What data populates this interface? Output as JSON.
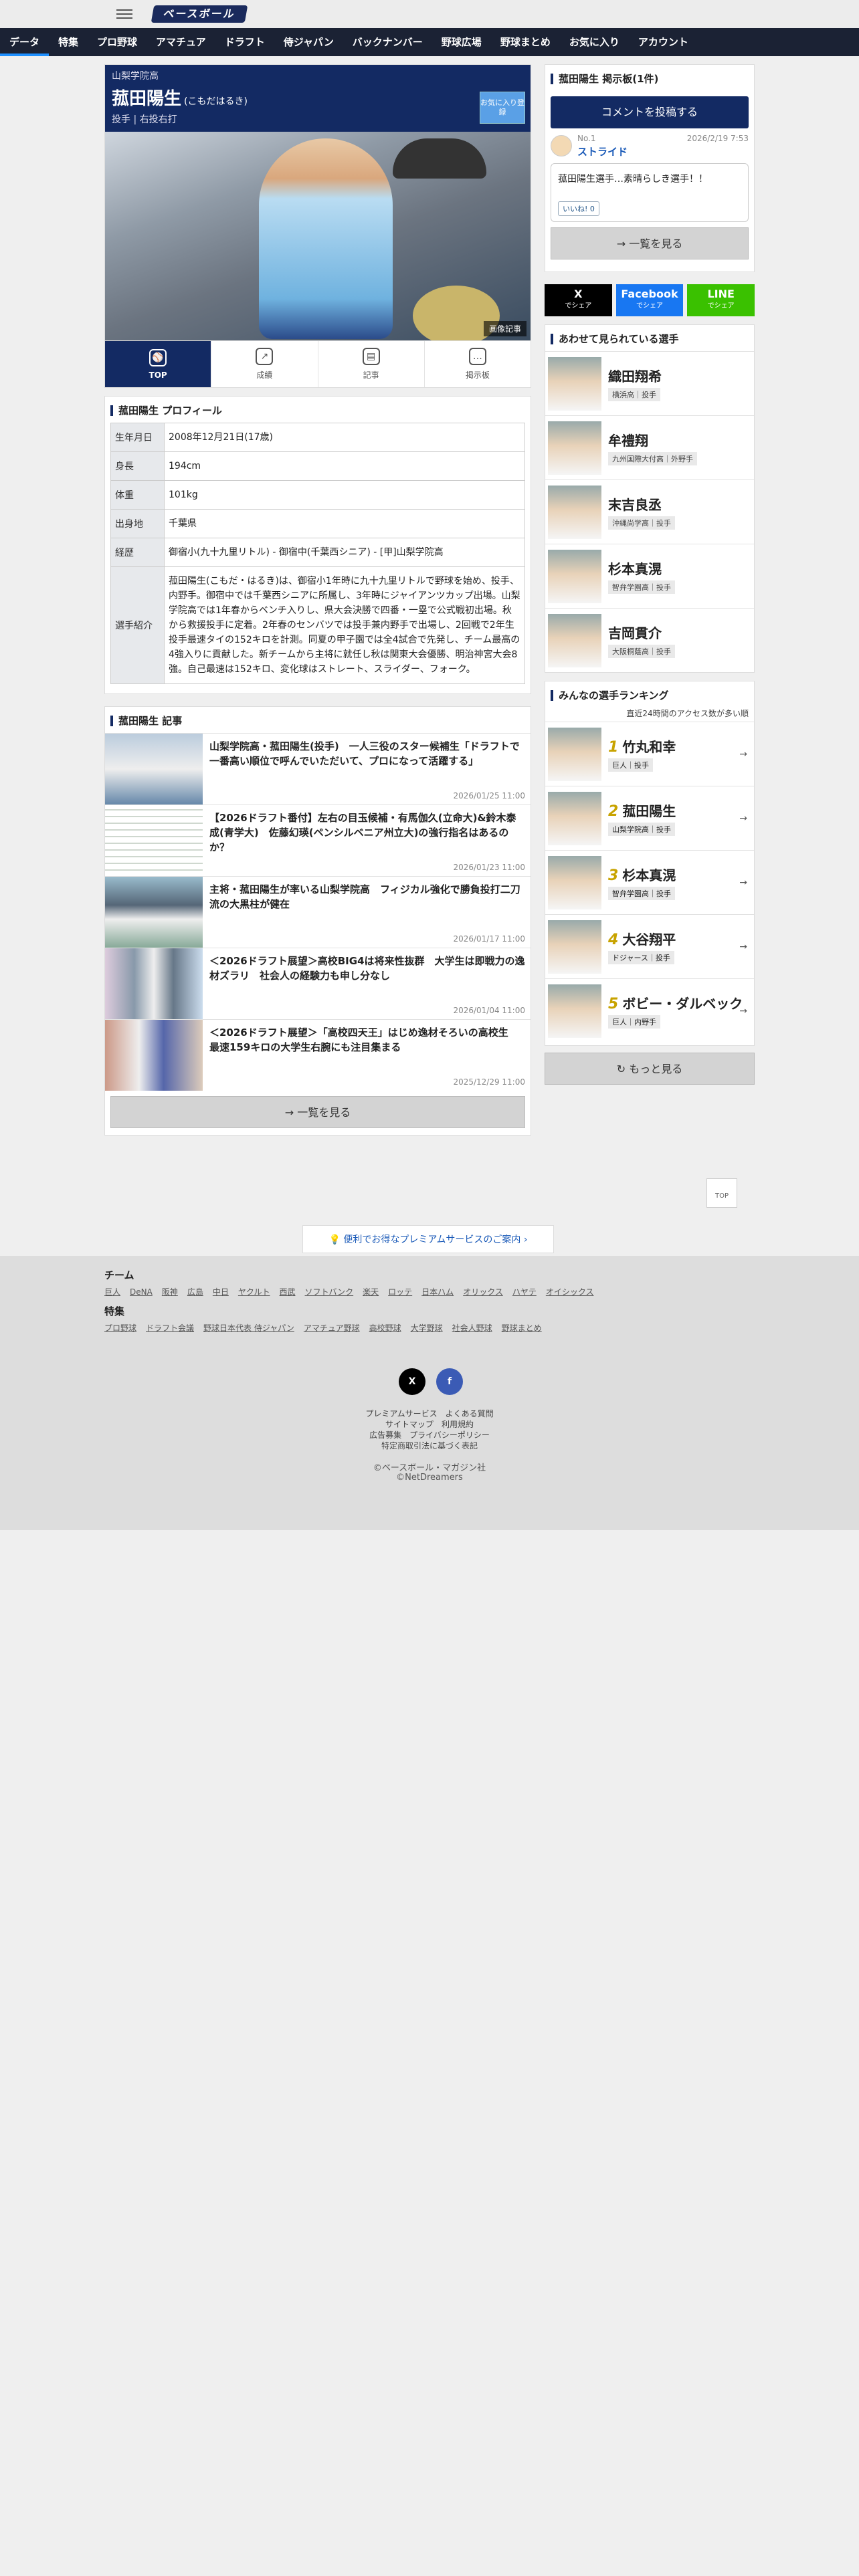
{
  "header": {
    "logo": "ベースボール"
  },
  "nav": [
    "データ",
    "特集",
    "プロ野球",
    "アマチュア",
    "ドラフト",
    "侍ジャパン",
    "バックナンバー",
    "野球広場",
    "野球まとめ",
    "お気に入り",
    "アカウント"
  ],
  "player": {
    "school": "山梨学院高",
    "name": "菰田陽生",
    "kana": "(こもだはるき)",
    "position": "投手 | 右投右打",
    "fav_label": "お気に入り登録",
    "image_tag": "画像記事"
  },
  "tabs": [
    "TOP",
    "成績",
    "記事",
    "掲示板"
  ],
  "profile": {
    "title": "菰田陽生 プロフィール",
    "rows": [
      {
        "k": "生年月日",
        "v": "2008年12月21日(17歳)"
      },
      {
        "k": "身長",
        "v": "194cm"
      },
      {
        "k": "体重",
        "v": "101kg"
      },
      {
        "k": "出身地",
        "v": "千葉県"
      },
      {
        "k": "経歴",
        "v": "御宿小(九十九里リトル) - 御宿中(千葉西シニア) - [甲]山梨学院高"
      },
      {
        "k": "選手紹介",
        "v": "菰田陽生(こもだ・はるき)は、御宿小1年時に九十九里リトルで野球を始め、投手、内野手。御宿中では千葉西シニアに所属し、3年時にジャイアンツカップ出場。山梨学院高では1年春からベンチ入りし、県大会決勝で四番・一塁で公式戦初出場。秋から救援投手に定着。2年春のセンバツでは投手兼内野手で出場し、2回戦で2年生投手最速タイの152キロを計測。同夏の甲子園では全4試合で先発し、チーム最高の4強入りに貢献した。新チームから主将に就任し秋は関東大会優勝、明治神宮大会8強。自己最速は152キロ、変化球はストレート、スライダー、フォーク。"
      }
    ]
  },
  "articles": {
    "title": "菰田陽生 記事",
    "items": [
      {
        "t": "山梨学院高・菰田陽生(投手)　一人三役のスター候補生「ドラフトで一番高い順位で呼んでいただいて、プロになって活躍する」",
        "d": "2026/01/25 11:00"
      },
      {
        "t": "【2026ドラフト番付】左右の目玉候補・有馬伽久(立命大)&鈴木泰成(青学大)　佐藤幻瑛(ペンシルベニア州立大)の強行指名はあるのか？",
        "d": "2026/01/23 11:00"
      },
      {
        "t": "主将・菰田陽生が率いる山梨学院高　フィジカル強化で勝負投打二刀流の大黒柱が健在",
        "d": "2026/01/17 11:00"
      },
      {
        "t": "＜2026ドラフト展望＞高校BIG4は将来性抜群　大学生は即戦力の逸材ズラリ　社会人の経験力も申し分なし",
        "d": "2026/01/04 11:00"
      },
      {
        "t": "＜2026ドラフト展望＞「高校四天王」はじめ逸材そろいの高校生　最速159キロの大学生右腕にも注目集まる",
        "d": "2025/12/29 11:00"
      }
    ],
    "more": "一覧を見る"
  },
  "board": {
    "title": "菰田陽生 掲示板(1件)",
    "post_btn": "コメントを投稿する",
    "comment": {
      "no": "No.1",
      "name": "ストライド",
      "date": "2026/2/19 7:53",
      "text": "菰田陽生選手…素晴らしき選手！！",
      "like": "いいね! 0"
    },
    "more": "一覧を見る"
  },
  "share": [
    {
      "label": "X",
      "sub": "でシェア",
      "color": "#000000"
    },
    {
      "label": "Facebook",
      "sub": "でシェア",
      "color": "#1877f2"
    },
    {
      "label": "LINE",
      "sub": "でシェア",
      "color": "#3ac100"
    }
  ],
  "related": {
    "title": "あわせて見られている選手",
    "items": [
      {
        "name": "織田翔希",
        "tag": "横浜高｜投手"
      },
      {
        "name": "牟禮翔",
        "tag": "九州国際大付高｜外野手"
      },
      {
        "name": "末吉良丞",
        "tag": "沖縄尚学高｜投手"
      },
      {
        "name": "杉本真滉",
        "tag": "智弁学園高｜投手"
      },
      {
        "name": "吉岡貫介",
        "tag": "大阪桐蔭高｜投手"
      }
    ]
  },
  "ranking": {
    "title": "みんなの選手ランキング",
    "note": "直近24時間のアクセス数が多い順",
    "items": [
      {
        "rank": "1",
        "name": "竹丸和幸",
        "tag": "巨人｜投手"
      },
      {
        "rank": "2",
        "name": "菰田陽生",
        "tag": "山梨学院高｜投手"
      },
      {
        "rank": "3",
        "name": "杉本真滉",
        "tag": "智弁学園高｜投手"
      },
      {
        "rank": "4",
        "name": "大谷翔平",
        "tag": "ドジャース｜投手"
      },
      {
        "rank": "5",
        "name": "ボビー・ダルベック",
        "tag": "巨人｜内野手"
      }
    ],
    "more": "もっと見る"
  },
  "footer": {
    "premium": "便利でお得なプレミアムサービスのご案内",
    "top": "TOP",
    "team_title": "チーム",
    "teams": [
      "巨人",
      "DeNA",
      "阪神",
      "広島",
      "中日",
      "ヤクルト",
      "西武",
      "ソフトバンク",
      "楽天",
      "ロッテ",
      "日本ハム",
      "オリックス",
      "ハヤテ",
      "オイシックス"
    ],
    "feature_title": "特集",
    "features": [
      "プロ野球",
      "ドラフト会議",
      "野球日本代表 侍ジャパン",
      "アマチュア野球",
      "高校野球",
      "大学野球",
      "社会人野球",
      "野球まとめ"
    ],
    "links1": [
      "プレミアムサービス",
      "よくある質問"
    ],
    "links2": [
      "サイトマップ",
      "利用規約"
    ],
    "links3": [
      "広告募集",
      "プライバシーポリシー"
    ],
    "links4": [
      "特定商取引法に基づく表記"
    ],
    "copy1": "©ベースボール・マガジン社",
    "copy2": "©NetDreamers"
  }
}
